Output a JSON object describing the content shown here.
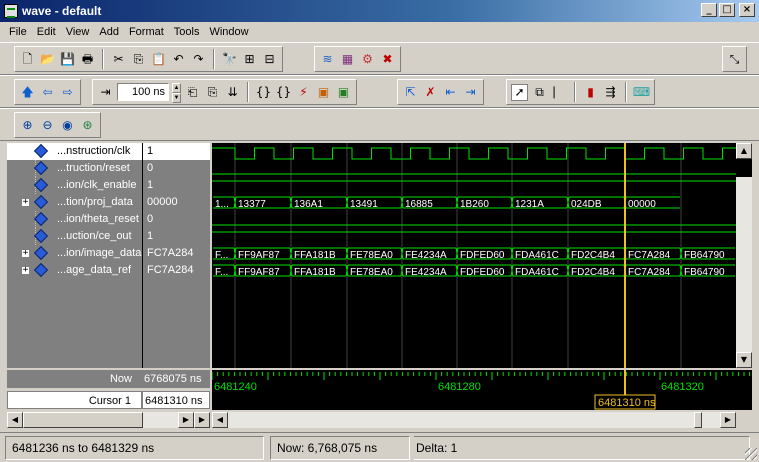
{
  "window": {
    "title": "wave - default"
  },
  "menu": [
    "File",
    "Edit",
    "View",
    "Add",
    "Format",
    "Tools",
    "Window"
  ],
  "toolbar": {
    "zoom_value": "100 ns"
  },
  "signals": [
    {
      "name": "...nstruction/clk",
      "value": "1",
      "expandable": false,
      "selected": true
    },
    {
      "name": "...truction/reset",
      "value": "0",
      "expandable": false,
      "selected": false
    },
    {
      "name": "...ion/clk_enable",
      "value": "1",
      "expandable": false,
      "selected": false
    },
    {
      "name": "...tion/proj_data",
      "value": "00000",
      "expandable": true,
      "selected": false
    },
    {
      "name": "...ion/theta_reset",
      "value": "0",
      "expandable": false,
      "selected": false
    },
    {
      "name": "...uction/ce_out",
      "value": "1",
      "expandable": false,
      "selected": false
    },
    {
      "name": "...ion/image_data",
      "value": "FC7A284",
      "expandable": true,
      "selected": false
    },
    {
      "name": "...age_data_ref",
      "value": "FC7A284",
      "expandable": true,
      "selected": false
    }
  ],
  "waves": {
    "bus_values": {
      "proj_data": [
        "1...",
        "13377",
        "136A1",
        "13491",
        "16885",
        "1B260",
        "1231A",
        "024DB",
        "00000"
      ],
      "image_data": [
        "F...",
        "FF9AF87",
        "FFA181B",
        "FE78EA0",
        "FE4234A",
        "FDFED60",
        "FDA461C",
        "FD2C4B4",
        "FC7A284",
        "FB64790"
      ],
      "image_data_ref": [
        "F...",
        "FF9AF87",
        "FFA181B",
        "FE78EA0",
        "FE4234A",
        "FDFED60",
        "FDA461C",
        "FD2C4B4",
        "FC7A284",
        "FB64790"
      ]
    },
    "colors": {
      "signal": "#00e000",
      "cursor": "#f0c020",
      "background": "#000000",
      "grid": "#404040"
    }
  },
  "timeline": {
    "now_label": "Now",
    "now_value": "6768075 ns",
    "cursor_label": "Cursor 1",
    "cursor_value": "6481310 ns",
    "ticks": [
      "6481240",
      "6481280",
      "6481320"
    ],
    "cursor_tag": "6481310 ns"
  },
  "status": {
    "range": "6481236 ns to 6481329 ns",
    "now": "Now: 6,768,075 ns",
    "delta": "Delta: 1"
  },
  "icons": [
    "new-icon",
    "open-icon",
    "save-icon",
    "print-icon",
    "cut-icon",
    "copy-icon",
    "paste-icon",
    "undo-icon",
    "redo-icon",
    "find-icon",
    "up-arrow-icon",
    "back-arrow-icon",
    "forward-arrow-icon",
    "zoom-in-icon",
    "zoom-out-icon",
    "zoom-fit-icon",
    "zoom-cursor-icon",
    "select-icon",
    "cursor-icon",
    "dock-icon"
  ]
}
